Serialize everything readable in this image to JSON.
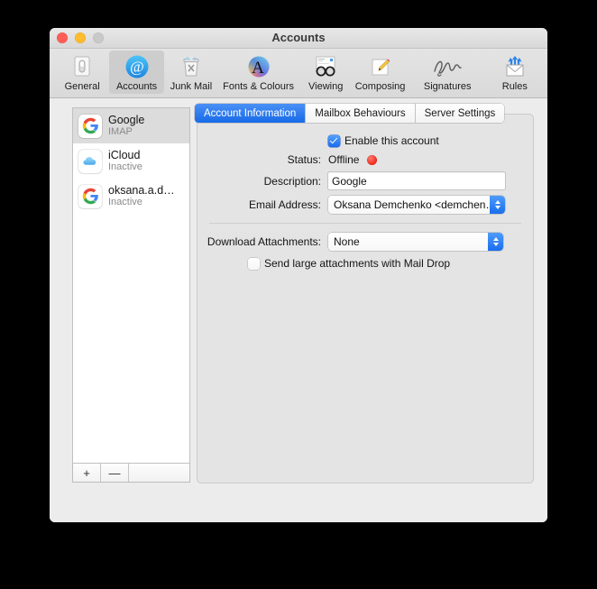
{
  "window": {
    "title": "Accounts",
    "traffic_lights": [
      "close",
      "minimize",
      "zoom"
    ]
  },
  "toolbar": {
    "items": [
      {
        "label": "General",
        "icon": "general-icon"
      },
      {
        "label": "Accounts",
        "icon": "at-sign-icon",
        "selected": true
      },
      {
        "label": "Junk Mail",
        "icon": "trash-x-icon"
      },
      {
        "label": "Fonts & Colours",
        "icon": "color-wheel-a-icon"
      },
      {
        "label": "Viewing",
        "icon": "glasses-icon"
      },
      {
        "label": "Composing",
        "icon": "pencil-note-icon"
      },
      {
        "label": "Signatures",
        "icon": "signature-icon"
      },
      {
        "label": "Rules",
        "icon": "envelope-arrows-icon"
      }
    ]
  },
  "sidebar": {
    "accounts": [
      {
        "name": "Google",
        "status": "IMAP",
        "icon": "google-icon",
        "selected": true
      },
      {
        "name": "iCloud",
        "status": "Inactive",
        "icon": "icloud-icon",
        "selected": false
      },
      {
        "name": "oksana.a.d…",
        "status": "Inactive",
        "icon": "google-icon",
        "selected": false
      }
    ],
    "add_label": "+",
    "remove_label": "—",
    "actions_label": ""
  },
  "tabs": [
    {
      "label": "Account Information",
      "active": true
    },
    {
      "label": "Mailbox Behaviours",
      "active": false
    },
    {
      "label": "Server Settings",
      "active": false
    }
  ],
  "form": {
    "enable_account": {
      "label": "Enable this account",
      "checked": true
    },
    "status": {
      "label": "Status:",
      "value": "Offline",
      "indicator_color": "#f2281b"
    },
    "description": {
      "label": "Description:",
      "value": "Google"
    },
    "email": {
      "label": "Email Address:",
      "value": "Oksana Demchenko <demchen…"
    },
    "download_attachments": {
      "label": "Download Attachments:",
      "value": "None"
    },
    "mail_drop": {
      "label": "Send large attachments with Mail Drop",
      "checked": false
    }
  },
  "help_button": {
    "label": "?"
  },
  "colors": {
    "accent": "#1b6ced",
    "window_bg": "#ececec",
    "pane_bg": "#e4e4e4",
    "status_offline": "#f2281b"
  }
}
